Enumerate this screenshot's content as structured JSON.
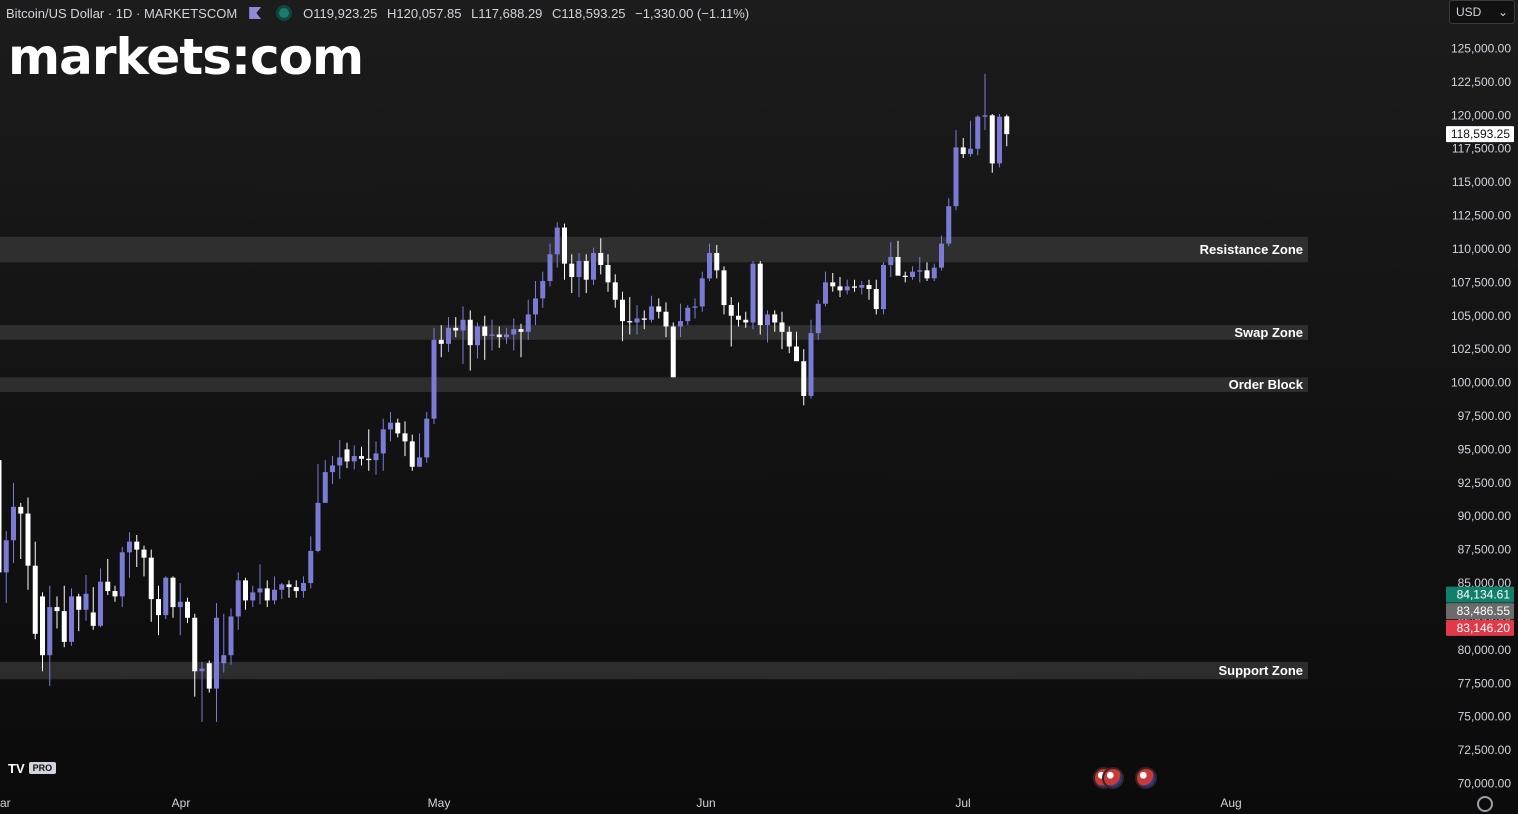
{
  "header": {
    "symbol": "Bitcoin/US Dollar · 1D · MARKETSCOM",
    "open": "O119,923.25",
    "high": "H120,057.85",
    "low": "L117,688.29",
    "close": "C118,593.25",
    "change": "−1,330.00 (−1.11%)"
  },
  "brand": {
    "logo_text": "markets:com",
    "footer_logo": "TV",
    "footer_badge": "PRO"
  },
  "currency_select": {
    "value": "USD"
  },
  "colors": {
    "up": "#7b7bd6",
    "down": "#ffffff",
    "zone": "#3a3a3a",
    "bid": "#10806a",
    "ask": "#e03a4a",
    "mid": "#6b6b6b"
  },
  "chart_data": {
    "type": "candlestick",
    "ylim": [
      68750,
      127500
    ],
    "y_ticks": [
      "125,000.00",
      "122,500.00",
      "120,000.00",
      "117,500.00",
      "115,000.00",
      "112,500.00",
      "110,000.00",
      "107,500.00",
      "105,000.00",
      "102,500.00",
      "100,000.00",
      "97,500.00",
      "95,000.00",
      "92,500.00",
      "90,000.00",
      "87,500.00",
      "85,000.00",
      "82,500.00",
      "80,000.00",
      "77,500.00",
      "75,000.00",
      "72,500.00",
      "70,000.00"
    ],
    "x_ticks": [
      "ar",
      "Apr",
      "May",
      "Jun",
      "Jul",
      "Aug"
    ],
    "price_labels": {
      "last": "118,593.25",
      "bid": "84,134.61",
      "mid": "83,486.55",
      "ask": "83,146.20"
    },
    "zones": [
      {
        "label": "Resistance Zone",
        "from": 109000,
        "to": 110900
      },
      {
        "label": "Swap Zone",
        "from": 103200,
        "to": 104300
      },
      {
        "label": "Order Block",
        "from": 99300,
        "to": 100400
      },
      {
        "label": "Support Zone",
        "from": 77800,
        "to": 79100
      }
    ],
    "candles": [
      {
        "o": 94200,
        "h": 94800,
        "l": 85300,
        "c": 85800
      },
      {
        "o": 85800,
        "h": 88900,
        "l": 83500,
        "c": 88200
      },
      {
        "o": 88200,
        "h": 92500,
        "l": 86500,
        "c": 90700
      },
      {
        "o": 90700,
        "h": 91000,
        "l": 86800,
        "c": 90200
      },
      {
        "o": 90200,
        "h": 91400,
        "l": 84500,
        "c": 86300
      },
      {
        "o": 86300,
        "h": 88100,
        "l": 80800,
        "c": 81200
      },
      {
        "o": 84000,
        "h": 84300,
        "l": 78400,
        "c": 79600
      },
      {
        "o": 79600,
        "h": 84800,
        "l": 77300,
        "c": 83200
      },
      {
        "o": 83200,
        "h": 84000,
        "l": 81600,
        "c": 82900
      },
      {
        "o": 82900,
        "h": 84800,
        "l": 80200,
        "c": 80600
      },
      {
        "o": 80600,
        "h": 84600,
        "l": 80300,
        "c": 84000
      },
      {
        "o": 84000,
        "h": 84200,
        "l": 81400,
        "c": 83000
      },
      {
        "o": 83000,
        "h": 85600,
        "l": 82200,
        "c": 84200
      },
      {
        "o": 82800,
        "h": 84700,
        "l": 81500,
        "c": 81800
      },
      {
        "o": 81800,
        "h": 86100,
        "l": 81700,
        "c": 85100
      },
      {
        "o": 85100,
        "h": 86800,
        "l": 84100,
        "c": 84400
      },
      {
        "o": 84400,
        "h": 84800,
        "l": 83600,
        "c": 84000
      },
      {
        "o": 84000,
        "h": 87700,
        "l": 83200,
        "c": 87300
      },
      {
        "o": 87300,
        "h": 88800,
        "l": 85400,
        "c": 88100
      },
      {
        "o": 88100,
        "h": 88600,
        "l": 86200,
        "c": 87500
      },
      {
        "o": 87500,
        "h": 87800,
        "l": 85500,
        "c": 86900
      },
      {
        "o": 86900,
        "h": 87500,
        "l": 82100,
        "c": 83800
      },
      {
        "o": 83800,
        "h": 84800,
        "l": 81100,
        "c": 82600
      },
      {
        "o": 82600,
        "h": 85500,
        "l": 82300,
        "c": 85400
      },
      {
        "o": 85400,
        "h": 85500,
        "l": 82400,
        "c": 83200
      },
      {
        "o": 83200,
        "h": 85000,
        "l": 81100,
        "c": 83600
      },
      {
        "o": 83600,
        "h": 83900,
        "l": 82000,
        "c": 82400
      },
      {
        "o": 82400,
        "h": 82700,
        "l": 76500,
        "c": 78400
      },
      {
        "o": 78400,
        "h": 79100,
        "l": 74600,
        "c": 78600
      },
      {
        "o": 79000,
        "h": 79200,
        "l": 76800,
        "c": 77100
      },
      {
        "o": 77100,
        "h": 83500,
        "l": 74600,
        "c": 82400
      },
      {
        "o": 79000,
        "h": 82700,
        "l": 78300,
        "c": 79600
      },
      {
        "o": 79600,
        "h": 83100,
        "l": 78900,
        "c": 82500
      },
      {
        "o": 82500,
        "h": 85800,
        "l": 81500,
        "c": 85200
      },
      {
        "o": 85200,
        "h": 85400,
        "l": 83000,
        "c": 83700
      },
      {
        "o": 83700,
        "h": 84800,
        "l": 83200,
        "c": 84300
      },
      {
        "o": 84300,
        "h": 86400,
        "l": 83400,
        "c": 84600
      },
      {
        "o": 84600,
        "h": 85200,
        "l": 83200,
        "c": 83700
      },
      {
        "o": 83700,
        "h": 85500,
        "l": 83400,
        "c": 84500
      },
      {
        "o": 84500,
        "h": 85000,
        "l": 83800,
        "c": 84900
      },
      {
        "o": 84900,
        "h": 85200,
        "l": 83900,
        "c": 84700
      },
      {
        "o": 84700,
        "h": 85200,
        "l": 83900,
        "c": 84400
      },
      {
        "o": 84400,
        "h": 85500,
        "l": 83900,
        "c": 85000
      },
      {
        "o": 85000,
        "h": 88500,
        "l": 84600,
        "c": 87400
      },
      {
        "o": 87400,
        "h": 93900,
        "l": 87300,
        "c": 91000
      },
      {
        "o": 91000,
        "h": 94200,
        "l": 91300,
        "c": 93300
      },
      {
        "o": 93300,
        "h": 94500,
        "l": 92400,
        "c": 93800
      },
      {
        "o": 93800,
        "h": 95700,
        "l": 92800,
        "c": 94400
      },
      {
        "o": 95000,
        "h": 95500,
        "l": 93600,
        "c": 94100
      },
      {
        "o": 94100,
        "h": 95300,
        "l": 93500,
        "c": 94500
      },
      {
        "o": 94500,
        "h": 95200,
        "l": 93800,
        "c": 94300
      },
      {
        "o": 94300,
        "h": 96500,
        "l": 93400,
        "c": 94200
      },
      {
        "o": 94200,
        "h": 95600,
        "l": 93100,
        "c": 94700
      },
      {
        "o": 94700,
        "h": 97300,
        "l": 93400,
        "c": 96500
      },
      {
        "o": 96500,
        "h": 97800,
        "l": 95600,
        "c": 97000
      },
      {
        "o": 97000,
        "h": 97300,
        "l": 95900,
        "c": 96200
      },
      {
        "o": 96200,
        "h": 97100,
        "l": 94500,
        "c": 95600
      },
      {
        "o": 95600,
        "h": 96100,
        "l": 93400,
        "c": 93700
      },
      {
        "o": 93700,
        "h": 96200,
        "l": 93700,
        "c": 94400
      },
      {
        "o": 94400,
        "h": 97800,
        "l": 94000,
        "c": 97300
      },
      {
        "o": 97300,
        "h": 104100,
        "l": 96900,
        "c": 103200
      },
      {
        "o": 103200,
        "h": 104300,
        "l": 101900,
        "c": 102900
      },
      {
        "o": 102900,
        "h": 104900,
        "l": 102300,
        "c": 104100
      },
      {
        "o": 104100,
        "h": 104900,
        "l": 103400,
        "c": 103900
      },
      {
        "o": 103900,
        "h": 105700,
        "l": 101400,
        "c": 104700
      },
      {
        "o": 104700,
        "h": 105400,
        "l": 100900,
        "c": 102800
      },
      {
        "o": 102800,
        "h": 104500,
        "l": 101800,
        "c": 104200
      },
      {
        "o": 104200,
        "h": 105000,
        "l": 101700,
        "c": 103500
      },
      {
        "o": 103500,
        "h": 104700,
        "l": 102400,
        "c": 103600
      },
      {
        "o": 103600,
        "h": 104200,
        "l": 102600,
        "c": 103400
      },
      {
        "o": 103400,
        "h": 104100,
        "l": 102900,
        "c": 103600
      },
      {
        "o": 103600,
        "h": 104800,
        "l": 102400,
        "c": 104000
      },
      {
        "o": 104000,
        "h": 104400,
        "l": 101900,
        "c": 103800
      },
      {
        "o": 103800,
        "h": 106200,
        "l": 103200,
        "c": 105100
      },
      {
        "o": 105100,
        "h": 107600,
        "l": 104300,
        "c": 106300
      },
      {
        "o": 106300,
        "h": 108300,
        "l": 105600,
        "c": 107600
      },
      {
        "o": 107600,
        "h": 110400,
        "l": 107200,
        "c": 109600
      },
      {
        "o": 109600,
        "h": 112000,
        "l": 108600,
        "c": 111600
      },
      {
        "o": 111600,
        "h": 111900,
        "l": 107700,
        "c": 108900
      },
      {
        "o": 108900,
        "h": 109600,
        "l": 106700,
        "c": 107900
      },
      {
        "o": 107900,
        "h": 109700,
        "l": 106400,
        "c": 109100
      },
      {
        "o": 109100,
        "h": 109600,
        "l": 106700,
        "c": 107700
      },
      {
        "o": 107700,
        "h": 110100,
        "l": 107300,
        "c": 109700
      },
      {
        "o": 109700,
        "h": 110800,
        "l": 108100,
        "c": 108800
      },
      {
        "o": 108800,
        "h": 109600,
        "l": 106800,
        "c": 107500
      },
      {
        "o": 107500,
        "h": 108100,
        "l": 105600,
        "c": 106200
      },
      {
        "o": 106200,
        "h": 106800,
        "l": 103100,
        "c": 104600
      },
      {
        "o": 104600,
        "h": 106400,
        "l": 103600,
        "c": 104500
      },
      {
        "o": 104500,
        "h": 105800,
        "l": 103600,
        "c": 104800
      },
      {
        "o": 104800,
        "h": 105400,
        "l": 104000,
        "c": 104700
      },
      {
        "o": 104700,
        "h": 106500,
        "l": 104500,
        "c": 105700
      },
      {
        "o": 105700,
        "h": 106300,
        "l": 104800,
        "c": 105300
      },
      {
        "o": 105300,
        "h": 106000,
        "l": 103400,
        "c": 104200
      },
      {
        "o": 104200,
        "h": 104500,
        "l": 100400,
        "c": 100400
      },
      {
        "o": 104200,
        "h": 105900,
        "l": 103400,
        "c": 104600
      },
      {
        "o": 104600,
        "h": 105800,
        "l": 104300,
        "c": 105600
      },
      {
        "o": 105600,
        "h": 106300,
        "l": 104800,
        "c": 105700
      },
      {
        "o": 105700,
        "h": 108300,
        "l": 105300,
        "c": 107800
      },
      {
        "o": 107800,
        "h": 110400,
        "l": 107600,
        "c": 109700
      },
      {
        "o": 109700,
        "h": 110300,
        "l": 107800,
        "c": 108400
      },
      {
        "o": 108400,
        "h": 108700,
        "l": 105100,
        "c": 105800
      },
      {
        "o": 105800,
        "h": 106400,
        "l": 102700,
        "c": 105000
      },
      {
        "o": 105000,
        "h": 106000,
        "l": 104200,
        "c": 104700
      },
      {
        "o": 104700,
        "h": 105300,
        "l": 104100,
        "c": 104500
      },
      {
        "o": 104500,
        "h": 109100,
        "l": 104000,
        "c": 108900
      },
      {
        "o": 108900,
        "h": 109100,
        "l": 103600,
        "c": 104300
      },
      {
        "o": 104300,
        "h": 105400,
        "l": 103000,
        "c": 105100
      },
      {
        "o": 105100,
        "h": 105400,
        "l": 103800,
        "c": 104500
      },
      {
        "o": 104500,
        "h": 105300,
        "l": 102500,
        "c": 103800
      },
      {
        "o": 103800,
        "h": 104200,
        "l": 102200,
        "c": 102700
      },
      {
        "o": 102700,
        "h": 103800,
        "l": 101800,
        "c": 101600
      },
      {
        "o": 101600,
        "h": 102500,
        "l": 98300,
        "c": 99000
      },
      {
        "o": 99000,
        "h": 104700,
        "l": 98800,
        "c": 103700
      },
      {
        "o": 103700,
        "h": 106200,
        "l": 103200,
        "c": 105900
      },
      {
        "o": 105900,
        "h": 108300,
        "l": 105700,
        "c": 107500
      },
      {
        "o": 107500,
        "h": 108200,
        "l": 106800,
        "c": 107200
      },
      {
        "o": 107200,
        "h": 107900,
        "l": 106400,
        "c": 106900
      },
      {
        "o": 106900,
        "h": 107700,
        "l": 106600,
        "c": 107200
      },
      {
        "o": 107200,
        "h": 107700,
        "l": 106800,
        "c": 107100
      },
      {
        "o": 107100,
        "h": 107600,
        "l": 106600,
        "c": 107300
      },
      {
        "o": 107300,
        "h": 107700,
        "l": 106200,
        "c": 107000
      },
      {
        "o": 107000,
        "h": 107700,
        "l": 105100,
        "c": 105500
      },
      {
        "o": 105500,
        "h": 109000,
        "l": 105100,
        "c": 108800
      },
      {
        "o": 108800,
        "h": 110500,
        "l": 107900,
        "c": 109400
      },
      {
        "o": 109400,
        "h": 110600,
        "l": 108600,
        "c": 108000
      },
      {
        "o": 108000,
        "h": 108300,
        "l": 107500,
        "c": 107900
      },
      {
        "o": 107900,
        "h": 108700,
        "l": 107700,
        "c": 108300
      },
      {
        "o": 108300,
        "h": 109400,
        "l": 107500,
        "c": 108400
      },
      {
        "o": 108400,
        "h": 109000,
        "l": 107600,
        "c": 107800
      },
      {
        "o": 107800,
        "h": 108900,
        "l": 107600,
        "c": 108600
      },
      {
        "o": 108600,
        "h": 111000,
        "l": 108400,
        "c": 110400
      },
      {
        "o": 110400,
        "h": 113800,
        "l": 110200,
        "c": 113200
      },
      {
        "o": 113200,
        "h": 118900,
        "l": 112900,
        "c": 117600
      },
      {
        "o": 117600,
        "h": 118300,
        "l": 116800,
        "c": 117100
      },
      {
        "o": 117100,
        "h": 119600,
        "l": 116900,
        "c": 117500
      },
      {
        "o": 117500,
        "h": 120000,
        "l": 117000,
        "c": 119900
      },
      {
        "o": 119900,
        "h": 123100,
        "l": 118900,
        "c": 120000
      },
      {
        "o": 120000,
        "h": 120100,
        "l": 115700,
        "c": 116400
      },
      {
        "o": 116400,
        "h": 120100,
        "l": 116100,
        "c": 119900
      },
      {
        "o": 119923,
        "h": 120058,
        "l": 117688,
        "c": 118593
      }
    ]
  }
}
